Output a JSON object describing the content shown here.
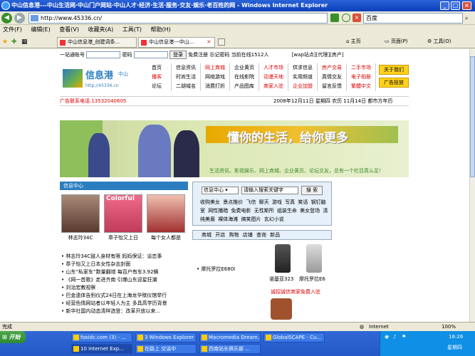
{
  "window": {
    "title": "中山信息港---中山生活网·中山门户网站·中山人才·经济·生活·服务·交友·娱乐·老百姓的网 - Windows Internet Explorer"
  },
  "addressbar": {
    "url": "http://www.45336.cn/",
    "search_placeholder": "百度"
  },
  "menu": {
    "items": [
      "文件(F)",
      "编辑(E)",
      "查看(V)",
      "收藏夹(A)",
      "工具(T)",
      "帮助(H)"
    ]
  },
  "tabs": {
    "items": [
      {
        "label": "中山信息港_创建词条..."
      },
      {
        "label": "中山信息港---中山..."
      }
    ],
    "right_tools": [
      "主页",
      "页面(P)",
      "工具(O)"
    ]
  },
  "page": {
    "login": {
      "account_label": "一站通账号",
      "password_label": "密码",
      "login_button": "登录",
      "register": "免费注册",
      "forgot": "忘记密码",
      "online": "当前在线1512人",
      "wap": "[wap站点]",
      "agent": "[代理]",
      "house": "[房产]"
    },
    "logo": {
      "text": "信息港",
      "sub": "中山",
      "domain": "http://45336.cn"
    },
    "nav_rows": [
      [
        "首页",
        "信息资讯",
        "网上商城",
        "企业黄页",
        "人才市场",
        "供求信息",
        "房产交易",
        "二手市场"
      ],
      [
        "播客",
        "时尚生活",
        "网络游戏",
        "在线影院",
        "动漫天地",
        "实用频道",
        "真情交友",
        "电子相册"
      ],
      [
        "论坛",
        "二胡域名",
        "消费打折",
        "产品图库",
        "商家入驻",
        "企业加盟",
        "留言反馈",
        "繁體中文"
      ]
    ],
    "side_buttons": [
      "关于我们",
      "广告投放"
    ],
    "ad_phone": "广告联系电话:13532040605",
    "date": "2008年12月11日 星期四 农历 11月14日 都市方年历",
    "banner": {
      "slogan": "懂你的生活，给你更多",
      "sub": "生活资讯、影视娱乐、网上商城、企业黄页、论坛交友，总有一个栏目真么足！"
    },
    "section_title": "信息中心",
    "thumbs": [
      {
        "caption": "林志玲34C"
      },
      {
        "caption": "章子怡又上日"
      },
      {
        "caption": "每个女人都是"
      }
    ],
    "thumb_brand": "Colorful",
    "news": [
      "林志玲34C鼓人身材有限 妈妈保证：谈恋事",
      "章子怡又上日本女性杂志封面",
      "山东“私家车”数量翻增 每百户有车3.92辆",
      "《网一首歌》走进齐南 引爆山东迎星狂潮",
      "刘治宏教视察",
      "巴金遗体告别仪式24日在上海龙华殡仪馆举行",
      "经营色情网站者以年轻人为主 多具高学历背景",
      "新华社国内动态清样选登：改革开放以来..."
    ],
    "search": {
      "select_value": "信息中心",
      "input_placeholder": "请输入搜索关键字",
      "button": "搜 索",
      "links": [
        "收购美女",
        "景点推价",
        "飞信",
        "聊天",
        "游戏",
        "写真",
        "笑话",
        "钢钉脑室",
        "网性播暗",
        "免费电影",
        "无性斯所",
        "组装生命",
        "美女登场",
        "清纯美眉",
        "裸体海滩",
        "搞笑图片",
        "玄幻小说"
      ]
    },
    "shop_tabs": [
      "商城",
      "开店",
      "购物",
      "店铺",
      "查询",
      "新品"
    ],
    "products": [
      {
        "name": "摩托罗拉E680I"
      },
      {
        "name": "诺基亚323"
      },
      {
        "name": "摩托罗拉E6"
      }
    ],
    "product_note": "诚招诚信商家免费入驻"
  },
  "status": {
    "left": "完成",
    "zone": "Internet",
    "zoom": "100%"
  },
  "taskbar": {
    "start": "开始",
    "tasks": [
      {
        "label": "foxidc.com (3) - ..."
      },
      {
        "label": "3 Windows Explorer"
      },
      {
        "label": "Macromedia Dream..."
      },
      {
        "label": "GlobalSCAPE - Cu..."
      },
      {
        "label": "10 Internet Exp..."
      },
      {
        "label": "在路上 交谈中"
      },
      {
        "label": "西南站长俱乐部 ..."
      }
    ],
    "time": "16:26",
    "day": "星期四"
  },
  "colors": {
    "accent": "#2a7ec0",
    "link_red": "#d00000",
    "taskbar": "#2458c8"
  }
}
